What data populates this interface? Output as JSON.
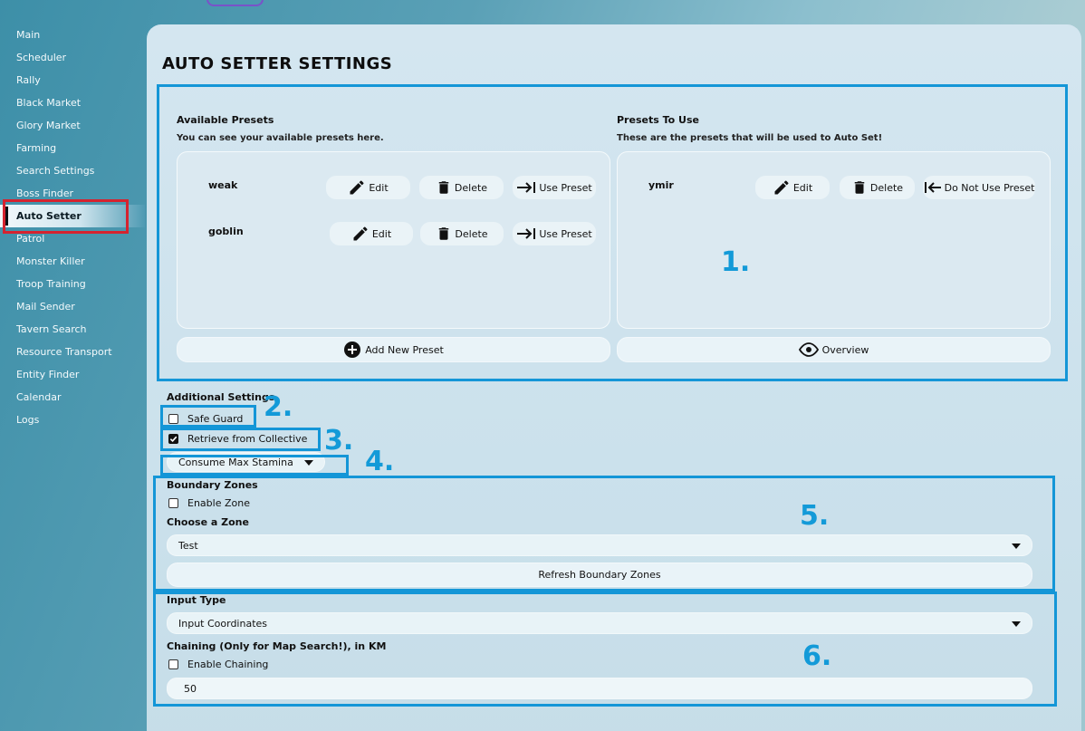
{
  "sidebar": {
    "items": [
      {
        "label": "Main"
      },
      {
        "label": "Scheduler"
      },
      {
        "label": "Rally"
      },
      {
        "label": "Black Market"
      },
      {
        "label": "Glory Market"
      },
      {
        "label": "Farming"
      },
      {
        "label": "Search Settings"
      },
      {
        "label": "Boss Finder"
      },
      {
        "label": "Auto Setter",
        "active": true
      },
      {
        "label": "Patrol"
      },
      {
        "label": "Monster Killer"
      },
      {
        "label": "Troop Training"
      },
      {
        "label": "Mail Sender"
      },
      {
        "label": "Tavern Search"
      },
      {
        "label": "Resource Transport"
      },
      {
        "label": "Entity Finder"
      },
      {
        "label": "Calendar"
      },
      {
        "label": "Logs"
      }
    ]
  },
  "page": {
    "title": "AUTO SETTER SETTINGS"
  },
  "available": {
    "title": "Available Presets",
    "desc": "You can see your available presets here.",
    "presets": [
      {
        "name": "weak",
        "edit": "Edit",
        "delete": "Delete",
        "use": "Use Preset"
      },
      {
        "name": "goblin",
        "edit": "Edit",
        "delete": "Delete",
        "use": "Use Preset"
      }
    ],
    "add_label": "Add New Preset"
  },
  "to_use": {
    "title": "Presets To Use",
    "desc": "These are the presets that will be used to Auto Set!",
    "presets": [
      {
        "name": "ymir",
        "edit": "Edit",
        "delete": "Delete",
        "unuse": "Do Not Use Preset"
      }
    ],
    "overview_label": "Overview"
  },
  "additional": {
    "title": "Additional Settings",
    "safe_guard": {
      "label": "Safe Guard",
      "checked": false
    },
    "retrieve": {
      "label": "Retrieve from Collective",
      "checked": true
    },
    "stamina": {
      "value": "Consume Max Stamina"
    }
  },
  "boundary": {
    "title": "Boundary Zones",
    "enable": {
      "label": "Enable Zone",
      "checked": false
    },
    "choose_label": "Choose a Zone",
    "zone": {
      "value": "Test"
    },
    "refresh_label": "Refresh Boundary Zones"
  },
  "input_type": {
    "title": "Input Type",
    "value": "Input Coordinates",
    "chaining_label": "Chaining (Only for Map Search!), in KM",
    "enable_chaining": {
      "label": "Enable Chaining",
      "checked": false
    },
    "chaining_value": "50"
  },
  "annotations": [
    "1.",
    "2.",
    "3.",
    "4.",
    "5.",
    "6."
  ],
  "colors": {
    "highlight": "#1496d7",
    "active_outline": "#d5232f"
  }
}
